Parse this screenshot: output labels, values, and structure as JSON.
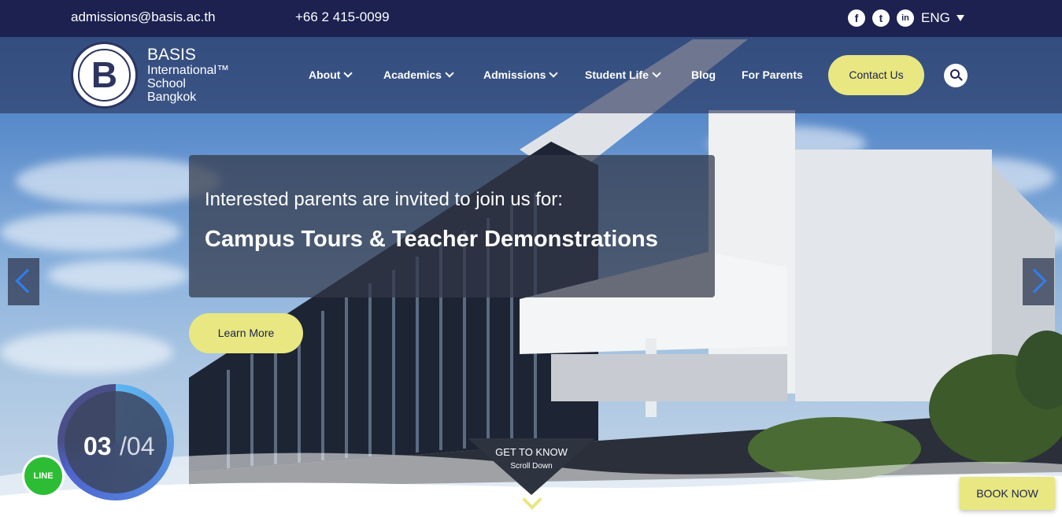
{
  "topbar": {
    "email": "admissions@basis.ac.th",
    "phone": "+66 2 415-0099",
    "social": [
      {
        "name": "facebook-icon",
        "glyph": "f"
      },
      {
        "name": "twitter-icon",
        "glyph": "t"
      },
      {
        "name": "linkedin-icon",
        "glyph": "in"
      }
    ],
    "language": "ENG"
  },
  "logo": {
    "mark": "B",
    "line1": "BASIS",
    "line2": "International™",
    "line3": "School",
    "line4": "Bangkok"
  },
  "nav": {
    "items": [
      {
        "label": "About",
        "dropdown": true
      },
      {
        "label": "Academics",
        "dropdown": true
      },
      {
        "label": "Admissions",
        "dropdown": true
      },
      {
        "label": "Student Life",
        "dropdown": true
      },
      {
        "label": "Blog",
        "dropdown": false
      },
      {
        "label": "For Parents",
        "dropdown": false
      }
    ],
    "contact_label": "Contact Us"
  },
  "hero": {
    "intro": "Interested parents are invited to join us for:",
    "headline": "Campus Tours & Teacher Demonstrations",
    "cta_label": "Learn More",
    "slide_current": "03",
    "slide_total": "/04",
    "scroll_title": "GET TO KNOW",
    "scroll_sub": "Scroll Down"
  },
  "line_badge": "LINE",
  "book_label": "BOOK NOW",
  "colors": {
    "topbar": "#1c2150",
    "accent": "#e8e781",
    "arrow": "#2f7ff0",
    "line_green": "#2dbd35"
  }
}
